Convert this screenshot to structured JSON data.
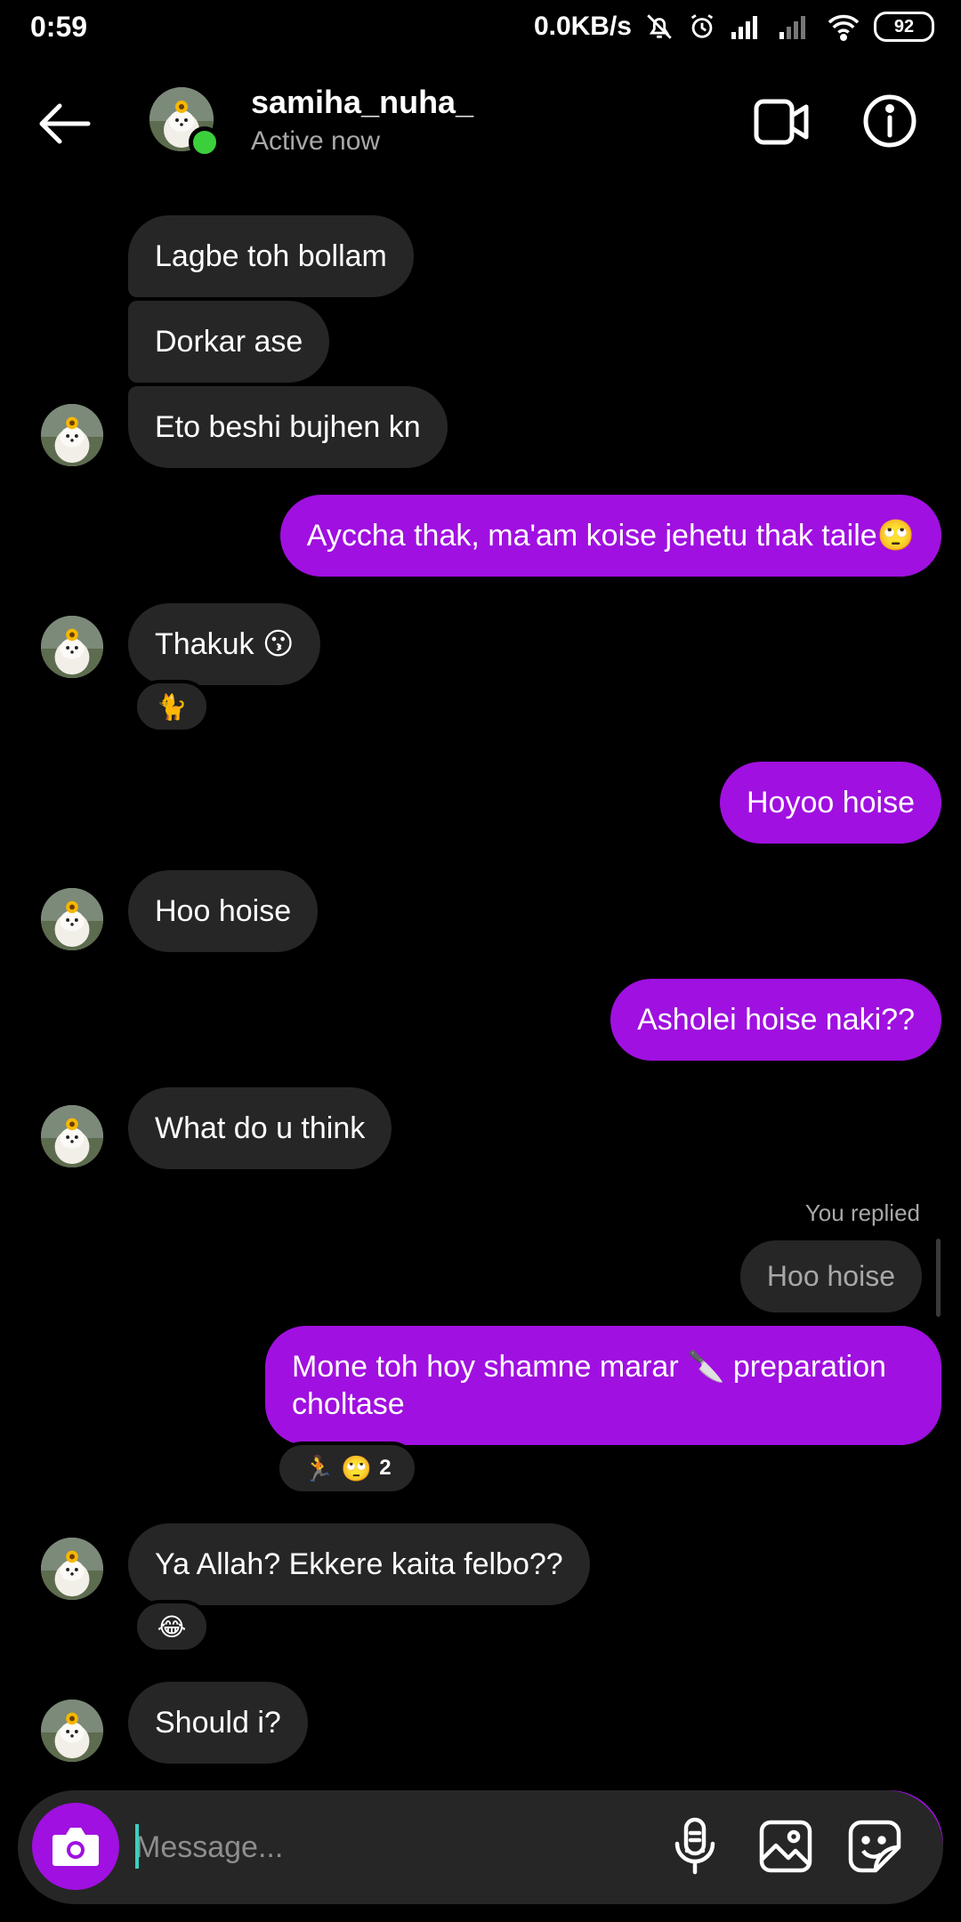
{
  "status_bar": {
    "time": "0:59",
    "net_speed": "0.0KB/s",
    "battery": "92"
  },
  "header": {
    "username": "samiha_nuha_",
    "status": "Active now"
  },
  "messages": {
    "m1": "Lagbe toh bollam",
    "m2": "Dorkar ase",
    "m3": "Eto beshi bujhen kn",
    "m4": "Ayccha thak, ma'am koise jehetu thak taile🙄",
    "m5": "Thakuk 😗",
    "m5_reaction": "🐈",
    "m6": "Hoyoo hoise",
    "m7": "Hoo hoise",
    "m8": "Asholei hoise naki??",
    "m9": "What do u think",
    "replied_label": "You replied",
    "replied_quote": "Hoo hoise",
    "m10_line1": "Mone toh hoy shamne marar 🔪 preparation",
    "m10_line2": "choltase",
    "m10_reaction_a": "🏃",
    "m10_reaction_b": "🙄",
    "m10_reaction_count": "2",
    "m11": "Ya Allah? Ekkere kaita felbo??",
    "m11_reaction": "😂",
    "m12": "Should i?"
  },
  "composer": {
    "placeholder": "Message..."
  },
  "colors": {
    "accent": "#a010e0",
    "incoming_bubble": "#262626",
    "online": "#3ccf3c"
  }
}
